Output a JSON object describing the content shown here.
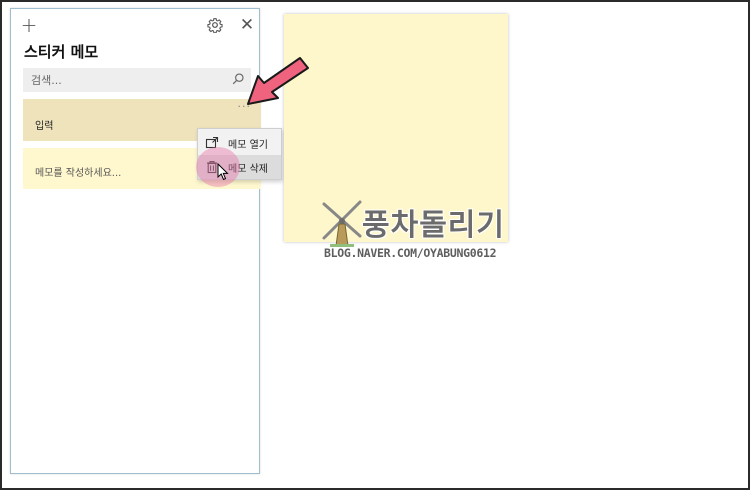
{
  "window": {
    "title": "스티커 메모",
    "add_glyph": "+",
    "close_glyph": "✕",
    "settings_icon": "gear-icon"
  },
  "search": {
    "placeholder": "검색...",
    "icon": "search-icon"
  },
  "notes": [
    {
      "text": "입력",
      "more": "···",
      "color": "#eee3bb"
    },
    {
      "text": "메모를 작성하세요...",
      "color": "#fff8cf"
    }
  ],
  "context_menu": {
    "items": [
      {
        "label": "메모 열기",
        "icon": "open-note-icon"
      },
      {
        "label": "메모 삭제",
        "icon": "trash-icon"
      }
    ]
  },
  "sticky_note": {
    "color": "#fff7cc"
  },
  "annotation": {
    "arrow_color": "#f0637f"
  },
  "watermark": {
    "title": "풍차돌리기",
    "url": "BLOG.NAVER.COM/OYABUNG0612"
  }
}
